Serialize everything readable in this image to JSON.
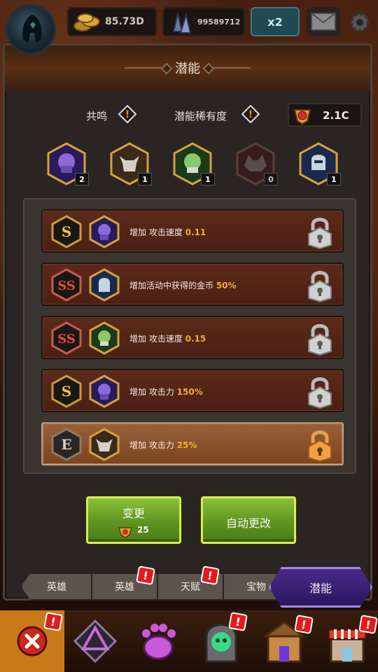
{
  "topbar": {
    "gold": "85.73D",
    "gems": "99589712",
    "multiplier": "x2"
  },
  "panel": {
    "title": "潜能",
    "resonance_label": "共鸣",
    "rarity_label": "潜能稀有度",
    "currency_value": "2.1C",
    "hero_counts": [
      "2",
      "1",
      "1",
      "0",
      "1"
    ],
    "rows": [
      {
        "rank": "S",
        "prefix": "增加 攻击速度 ",
        "value": "0.11",
        "hero": "purple"
      },
      {
        "rank": "SS",
        "prefix": "增加活动中获得的金币 ",
        "value": "50%",
        "hero": "blue"
      },
      {
        "rank": "SS",
        "prefix": "增加 攻击速度 ",
        "value": "0.15",
        "hero": "green"
      },
      {
        "rank": "S",
        "prefix": "增加 攻击力 ",
        "value": "150%",
        "hero": "purple"
      },
      {
        "rank": "E",
        "prefix": "增加 攻击力 ",
        "value": "25%",
        "hero": "bull"
      }
    ],
    "change_button": "变更",
    "change_cost": "25",
    "auto_button": "自动更改"
  },
  "tabs": [
    "英雄",
    "英雄",
    "天赋",
    "宝物",
    "潜能"
  ],
  "colors": {
    "accent_green": "#8cc23a",
    "highlight_yellow": "#f0b02a",
    "active_tab": "#4a2a8a",
    "alert_red": "#e51a1a"
  }
}
